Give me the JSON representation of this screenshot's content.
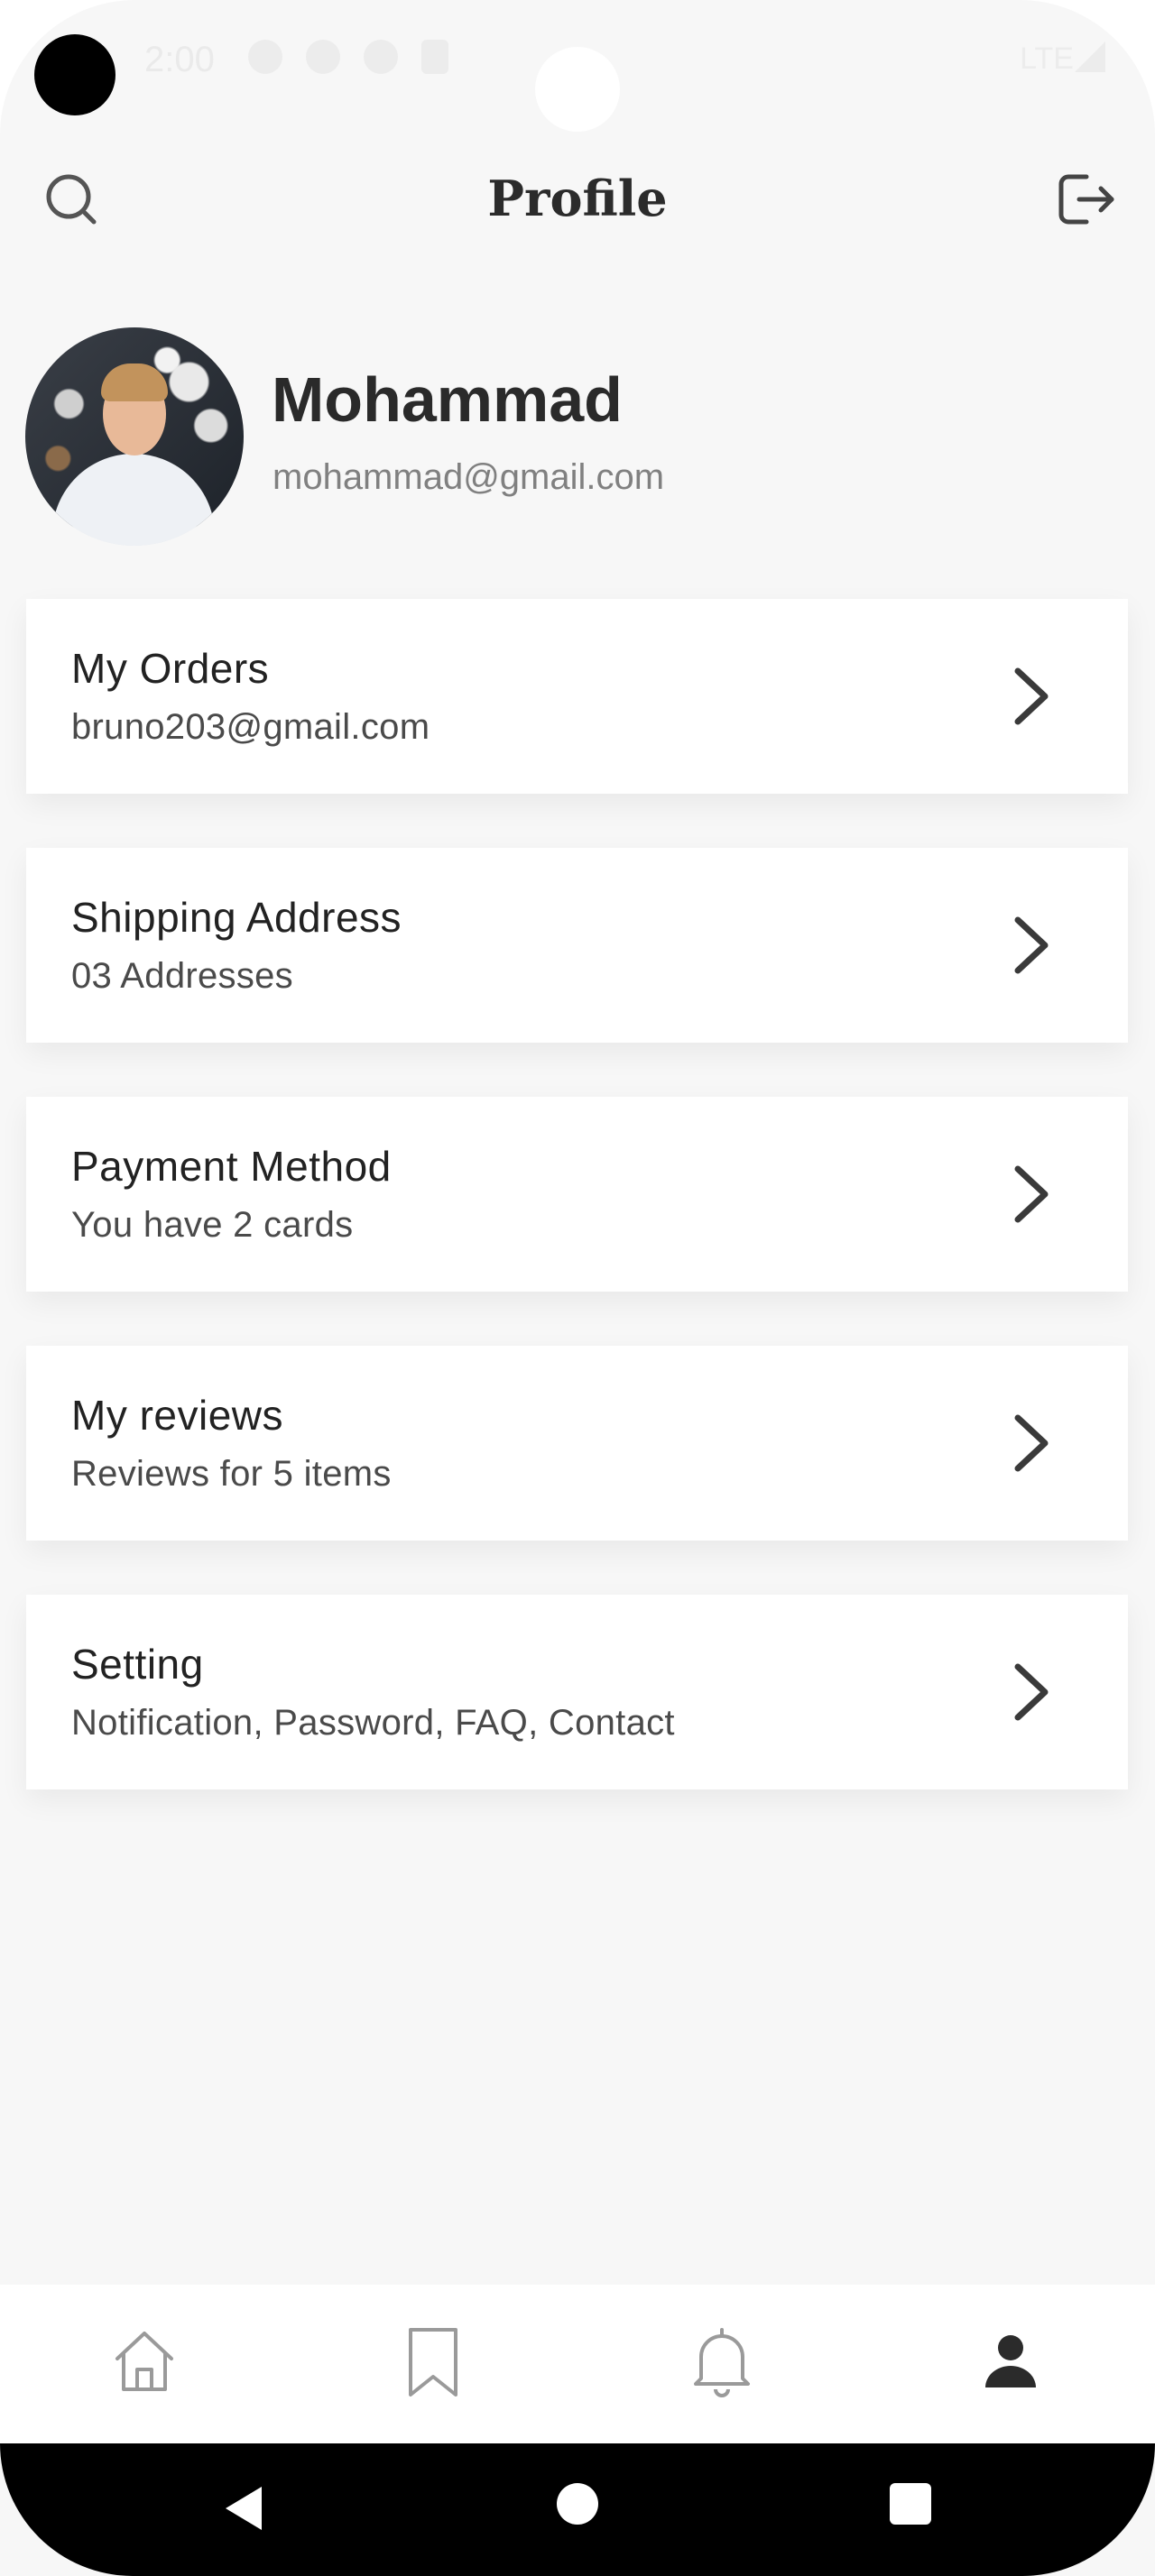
{
  "status_bar": {
    "time": "2:00",
    "network": "LTE"
  },
  "header": {
    "title": "Profile",
    "search_icon": "search-icon",
    "logout_icon": "logout-icon"
  },
  "profile": {
    "name": "Mohammad",
    "email": "mohammad@gmail.com"
  },
  "menu": [
    {
      "title": "My Orders",
      "subtitle": "bruno203@gmail.com"
    },
    {
      "title": "Shipping Address",
      "subtitle": "03 Addresses"
    },
    {
      "title": "Payment Method",
      "subtitle": "You have 2 cards"
    },
    {
      "title": "My reviews",
      "subtitle": "Reviews for 5 items"
    },
    {
      "title": "Setting",
      "subtitle": "Notification, Password, FAQ, Contact"
    }
  ],
  "bottom_nav": {
    "items": [
      "home-icon",
      "bookmark-icon",
      "bell-icon",
      "profile-icon"
    ],
    "active": "profile-icon"
  },
  "colors": {
    "background": "#f7f7f7",
    "card": "#ffffff",
    "active_icon": "#2b2b2b",
    "inactive_icon": "#9a9a9a"
  }
}
